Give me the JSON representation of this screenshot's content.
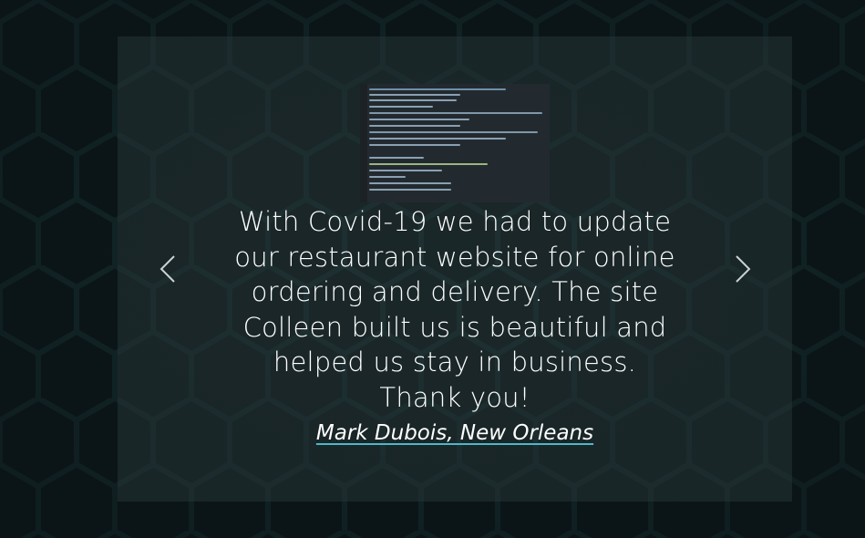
{
  "testimonial": {
    "quote": "With Covid-19 we had to update our restaurant website for online ordering and delivery. The site Colleen built us is beautiful and helped us stay in business. Thank you!",
    "author": "Mark Dubois, New Orleans"
  },
  "controls": {
    "prev_icon": "chevron-left-icon",
    "next_icon": "chevron-right-icon"
  },
  "colors": {
    "background": "#0a1214",
    "panel": "#263436",
    "text": "#ffffff",
    "link_underline": "#4fb6c9"
  }
}
